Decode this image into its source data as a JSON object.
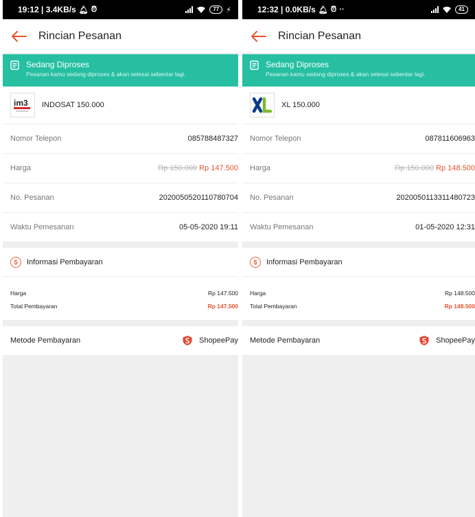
{
  "screens": [
    {
      "status_bar": {
        "left": "19:12 | 3.4KB/s",
        "battery": "77"
      },
      "appbar": {
        "title": "Rincian Pesanan"
      },
      "banner": {
        "title": "Sedang Diproses",
        "description": "Pesanan kamu sedang diproses & akan selesai sebentar lagi."
      },
      "product": {
        "name": "INDOSAT 150.000",
        "logo_text": "im3"
      },
      "rows": [
        {
          "label": "Nomor Telepon",
          "value": "085788487327"
        },
        {
          "label": "Harga",
          "original": "Rp 150.000",
          "value": "Rp 147.500"
        },
        {
          "label": "No. Pesanan",
          "value": "2020050520110780704"
        },
        {
          "label": "Waktu Pemesanan",
          "value": "05-05-2020 19:11"
        }
      ],
      "payment_info": {
        "title": "Informasi Pembayaran",
        "price_label": "Harga",
        "price_value": "Rp 147.500",
        "total_label": "Total Pembayaran",
        "total_value": "Rp 147.500"
      },
      "method": {
        "label": "Metode Pembayaran",
        "value": "ShopeePay"
      }
    },
    {
      "status_bar": {
        "left": "12:32 | 0.0KB/s",
        "battery": "41"
      },
      "appbar": {
        "title": "Rincian Pesanan"
      },
      "banner": {
        "title": "Sedang Diproses",
        "description": "Pesanan kamu sedang diproses & akan selesai sebentar lagi."
      },
      "product": {
        "name": "XL 150.000",
        "logo_text": "XL"
      },
      "rows": [
        {
          "label": "Nomor Telepon",
          "value": "087811606963"
        },
        {
          "label": "Harga",
          "original": "Rp 150.000",
          "value": "Rp 148.500"
        },
        {
          "label": "No. Pesanan",
          "value": "2020050113311480723"
        },
        {
          "label": "Waktu Pemesanan",
          "value": "01-05-2020 12:31"
        }
      ],
      "payment_info": {
        "title": "Informasi Pembayaran",
        "price_label": "Harga",
        "price_value": "Rp 148.500",
        "total_label": "Total Pembayaran",
        "total_value": "Rp 148.500"
      },
      "method": {
        "label": "Metode Pembayaran",
        "value": "ShopeePay"
      }
    }
  ],
  "icons": {
    "back": "arrow-left-icon",
    "banner": "document-icon",
    "payment_info": "dollar-coin-icon",
    "method": "shopeepay-icon"
  },
  "colors": {
    "accent": "#e2552f",
    "banner_bg": "#26bfa2",
    "strike_text": "#b5b5b5"
  }
}
